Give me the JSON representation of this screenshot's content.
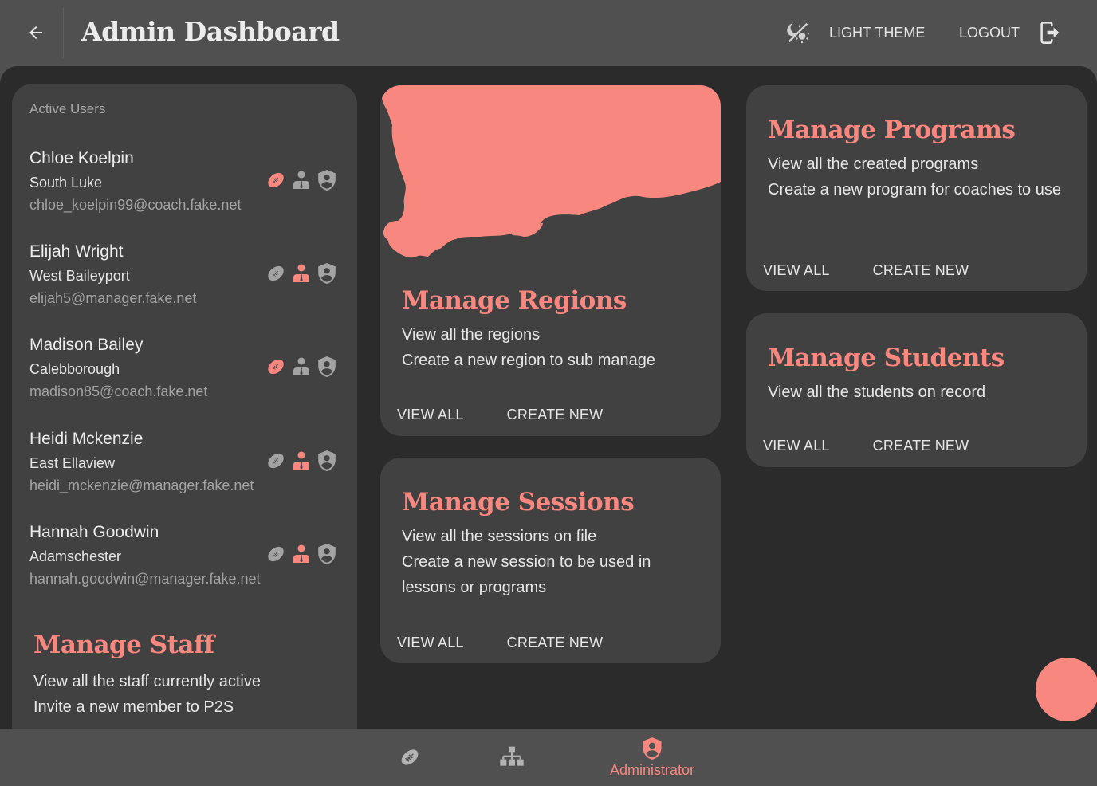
{
  "colors": {
    "accent": "#f88780",
    "appbar_bg": "#505050",
    "content_bg": "#2b2b2b",
    "card_bg": "#414141",
    "icon_inactive": "#a3a3a3"
  },
  "header": {
    "back_icon": "arrow-left-icon",
    "title": "Admin Dashboard",
    "theme_icon": "theme-light-dark-icon",
    "theme_label": "LIGHT THEME",
    "logout_label": "LOGOUT",
    "logout_icon": "logout-icon"
  },
  "active_users": {
    "heading": "Active Users",
    "users": [
      {
        "name": "Chloe Koelpin",
        "location": "South Luke",
        "email": "chloe_koelpin99@coach.fake.net",
        "roles": {
          "coach": true,
          "manager": false,
          "admin": false
        }
      },
      {
        "name": "Elijah Wright",
        "location": "West Baileyport",
        "email": "elijah5@manager.fake.net",
        "roles": {
          "coach": false,
          "manager": true,
          "admin": false
        }
      },
      {
        "name": "Madison Bailey",
        "location": "Calebborough",
        "email": "madison85@coach.fake.net",
        "roles": {
          "coach": true,
          "manager": false,
          "admin": false
        }
      },
      {
        "name": "Heidi Mckenzie",
        "location": "East Ellaview",
        "email": "heidi_mckenzie@manager.fake.net",
        "roles": {
          "coach": false,
          "manager": true,
          "admin": false
        }
      },
      {
        "name": "Hannah Goodwin",
        "location": "Adamschester",
        "email": "hannah.goodwin@manager.fake.net",
        "roles": {
          "coach": false,
          "manager": true,
          "admin": false
        }
      }
    ]
  },
  "staff": {
    "title": "Manage Staff",
    "lines": [
      "View all the staff currently active",
      "Invite a new member to P2S"
    ]
  },
  "regions": {
    "title": "Manage Regions",
    "lines": [
      "View all the regions",
      "Create a new region to sub manage"
    ],
    "view_all": "VIEW ALL",
    "create_new": "CREATE NEW"
  },
  "sessions": {
    "title": "Manage Sessions",
    "lines": [
      "View all the sessions on file",
      "Create a new session to be used in lessons or programs"
    ],
    "view_all": "VIEW ALL",
    "create_new": "CREATE NEW"
  },
  "programs": {
    "title": "Manage Programs",
    "lines": [
      "View all the created programs",
      "Create a new program for coaches to use"
    ],
    "view_all": "VIEW ALL",
    "create_new": "CREATE NEW"
  },
  "students": {
    "title": "Manage Students",
    "lines": [
      "View all the students on record"
    ],
    "view_all": "VIEW ALL",
    "create_new": "CREATE NEW"
  },
  "bottom_nav": {
    "items": [
      {
        "icon": "football-icon",
        "label": "",
        "active": false
      },
      {
        "icon": "hierarchy-icon",
        "label": "",
        "active": false
      },
      {
        "icon": "admin-shield-icon",
        "label": "Administrator",
        "active": true
      }
    ]
  }
}
